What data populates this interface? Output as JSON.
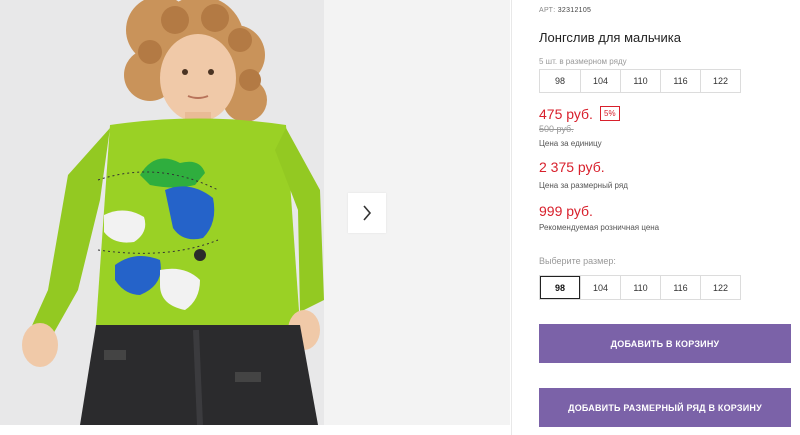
{
  "product": {
    "sku_label": "АРТ:",
    "sku_value": "32312105",
    "title": "Лонгслив для мальчика",
    "pack_caption": "5 шт. в размерном ряду",
    "pack_sizes": [
      "98",
      "104",
      "110",
      "116",
      "122"
    ],
    "price_unit": "475 руб.",
    "discount": "5%",
    "old_price": "500 руб.",
    "caption_unit": "Цена за единицу",
    "price_pack": "2 375 руб.",
    "caption_pack": "Цена за размерный ряд",
    "price_retail": "999 руб.",
    "caption_retail": "Рекомендуемая розничная цена",
    "pick_caption": "Выберите размер:",
    "pick_sizes": [
      "98",
      "104",
      "110",
      "116",
      "122"
    ],
    "selected_size": "98",
    "add_to_cart": "ДОБАВИТЬ В КОРЗИНУ",
    "add_pack_to_cart": "ДОБАВИТЬ РАЗМЕРНЫЙ РЯД В КОРЗИНУ"
  },
  "gallery": {
    "next_icon": "chevron-right-icon"
  },
  "colors": {
    "price": "#d8202c",
    "button": "#7b62a8",
    "shirt": "#9ad125"
  }
}
